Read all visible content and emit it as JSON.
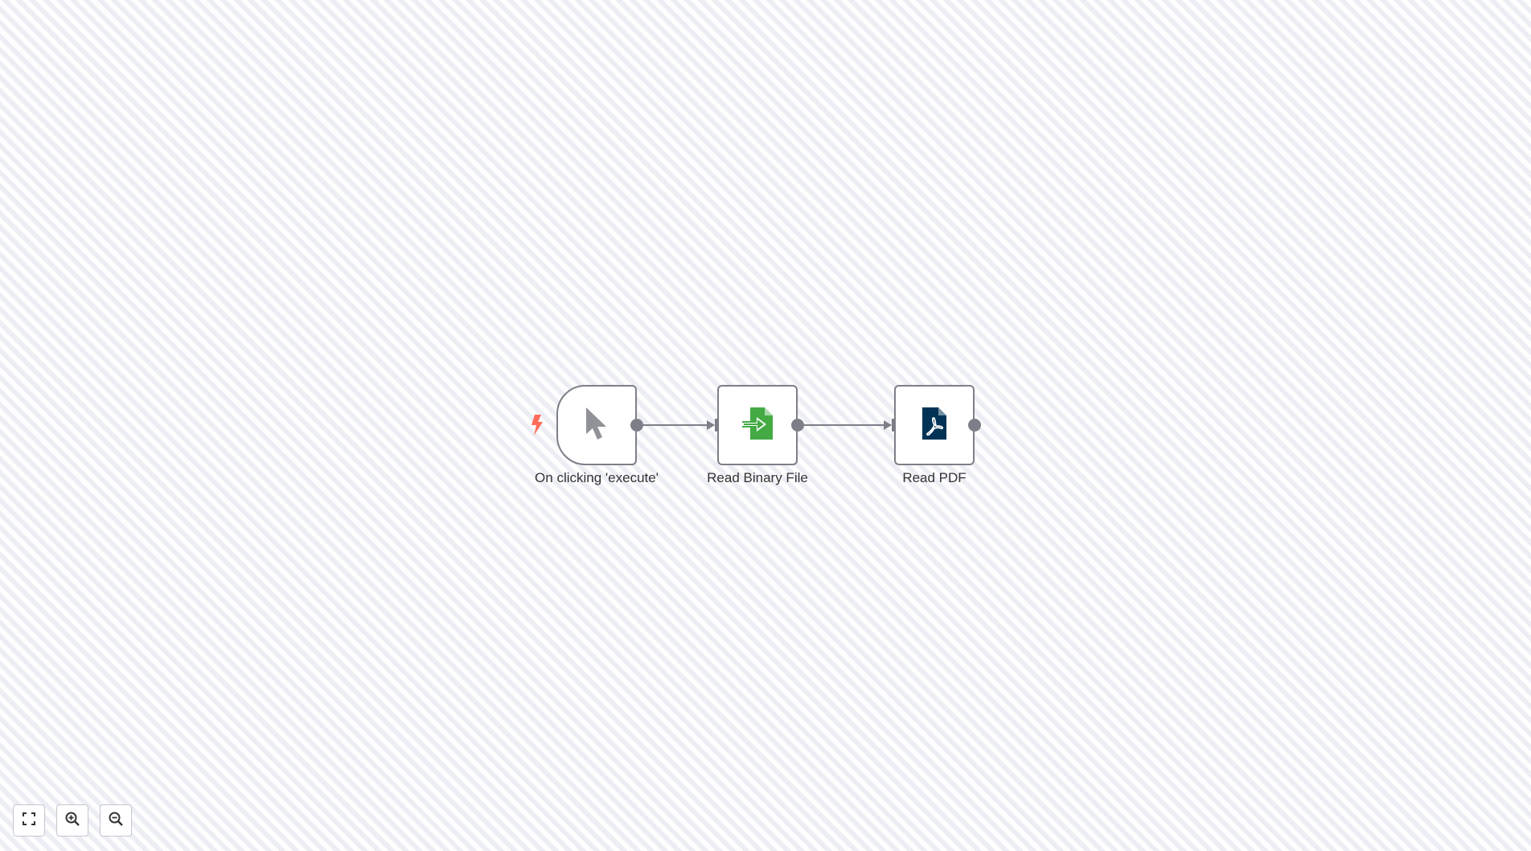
{
  "nodes": [
    {
      "id": "manual-trigger",
      "label": "On clicking 'execute'",
      "icon": "cursor-pointer-icon",
      "color": "#909298"
    },
    {
      "id": "read-binary-file",
      "label": "Read Binary File",
      "icon": "file-import-icon",
      "color": "#44aa44"
    },
    {
      "id": "read-pdf",
      "label": "Read PDF",
      "icon": "pdf-file-icon",
      "color": "#003355"
    }
  ],
  "colors": {
    "trigger_bolt": "#ff6d5a",
    "node_border": "#7d7f88",
    "edge": "#7d7f88"
  },
  "controls": {
    "fit_view_icon": "fit-view-icon",
    "zoom_in_icon": "zoom-in-icon",
    "zoom_out_icon": "zoom-out-icon"
  }
}
